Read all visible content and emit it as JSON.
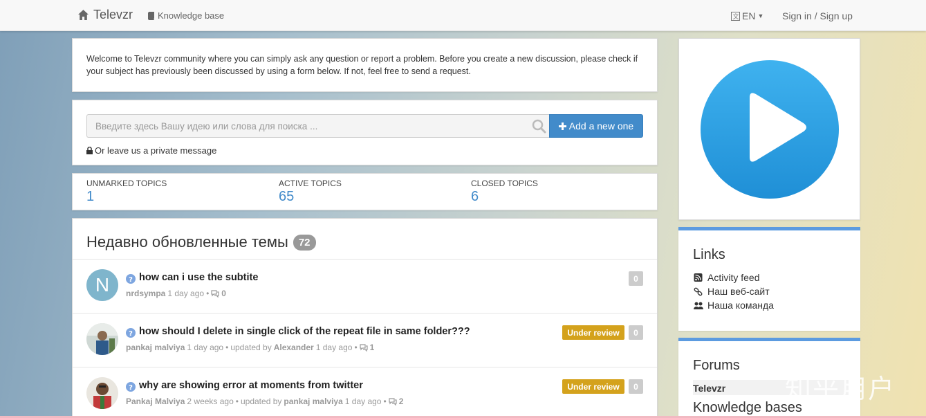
{
  "navbar": {
    "brand": "Televzr",
    "knowledge_base": "Knowledge base",
    "language": "EN",
    "signin": "Sign in / Sign up"
  },
  "welcome": {
    "text": "Welcome to Televzr community where you can simply ask any question or report a problem. Before you create a new discussion, please check if your subject has previously been discussed by using a form below. If not, feel free to send a request."
  },
  "search": {
    "placeholder": "Введите здесь Вашу идею или слова для поиска ...",
    "add_button": "Add a new one",
    "private_message": "Or leave us a private message"
  },
  "stats": [
    {
      "label": "UNMARKED TOPICS",
      "value": "1"
    },
    {
      "label": "ACTIVE TOPICS",
      "value": "65"
    },
    {
      "label": "CLOSED TOPICS",
      "value": "6"
    }
  ],
  "topics": {
    "heading": "Недавно обновленные темы",
    "count": "72",
    "items": [
      {
        "avatar_letter": "N",
        "title": "how can i use the subtite",
        "author": "nrdsympa",
        "time": "1 day ago",
        "updated_label": "",
        "updated_by": "",
        "updated_time": "",
        "comments": "0",
        "status": "",
        "votes": "0"
      },
      {
        "avatar_letter": "",
        "title": "how should I delete in single click of the repeat file in same folder???",
        "author": "pankaj malviya",
        "time": "1 day ago",
        "updated_label": "updated by",
        "updated_by": "Alexander",
        "updated_time": "1 day ago",
        "comments": "1",
        "status": "Under review",
        "votes": "0"
      },
      {
        "avatar_letter": "",
        "title": "why are showing error at moments from twitter",
        "author": "Pankaj Malviya",
        "time": "2 weeks ago",
        "updated_label": "updated by",
        "updated_by": "pankaj malviya",
        "updated_time": "1 day ago",
        "comments": "2",
        "status": "Under review",
        "votes": "0"
      }
    ]
  },
  "sidebar": {
    "links_title": "Links",
    "links": [
      {
        "label": "Activity feed",
        "icon": "rss-icon"
      },
      {
        "label": "Наш веб-сайт",
        "icon": "link-icon"
      },
      {
        "label": "Наша команда",
        "icon": "users-icon"
      }
    ],
    "forums_title": "Forums",
    "forums": [
      {
        "label": "Televzr"
      }
    ],
    "knowledge_bases_title": "Knowledge bases"
  },
  "watermark": "知乎用户",
  "colors": {
    "primary": "#428bca",
    "review": "#d4a21c",
    "logo_blue": "#2b9ae0",
    "side_accent": "#5c9be0"
  }
}
